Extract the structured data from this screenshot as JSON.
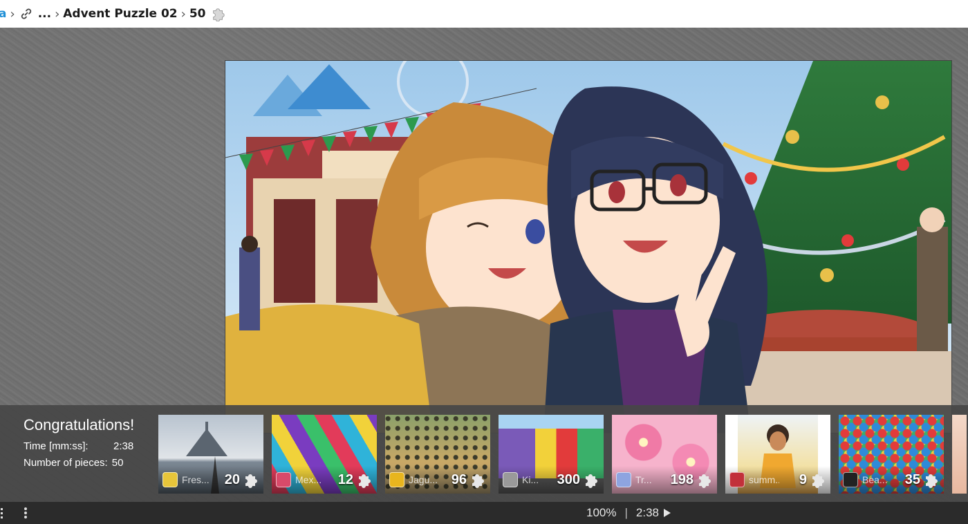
{
  "breadcrumb": {
    "app": "a",
    "ellipsis": "...",
    "puzzle": "Advent Puzzle 02",
    "pieces": "50"
  },
  "results": {
    "title": "Congratulations!",
    "time_label": "Time [mm:ss]:",
    "time_value": "2:38",
    "pieces_label": "Number of pieces:",
    "pieces_value": "50"
  },
  "thumbnails": [
    {
      "name": "Fres...",
      "count": "20",
      "avatar_color": "#e7c53a",
      "scene": "abbey"
    },
    {
      "name": "Mex...",
      "count": "12",
      "avatar_color": "#d94a6a",
      "scene": "guitars"
    },
    {
      "name": "Jagu...",
      "count": "96",
      "avatar_color": "#e8b51e",
      "scene": "jaguar"
    },
    {
      "name": "Ki...",
      "count": "300",
      "avatar_color": "#9a9a9a",
      "scene": "houses"
    },
    {
      "name": "Tr...",
      "count": "198",
      "avatar_color": "#8ea4e0",
      "scene": "flowers"
    },
    {
      "name": "summ...",
      "count": "9",
      "avatar_color": "#c2303a",
      "scene": "summer"
    },
    {
      "name": "Bea...",
      "count": "35",
      "avatar_color": "#222222",
      "scene": "beads"
    }
  ],
  "status": {
    "zoom": "100%",
    "divider": "|",
    "timer": "2:38"
  },
  "colors": {
    "accent": "#1f8fd6",
    "panel": "#464646",
    "statusbar": "#2b2b2b"
  }
}
